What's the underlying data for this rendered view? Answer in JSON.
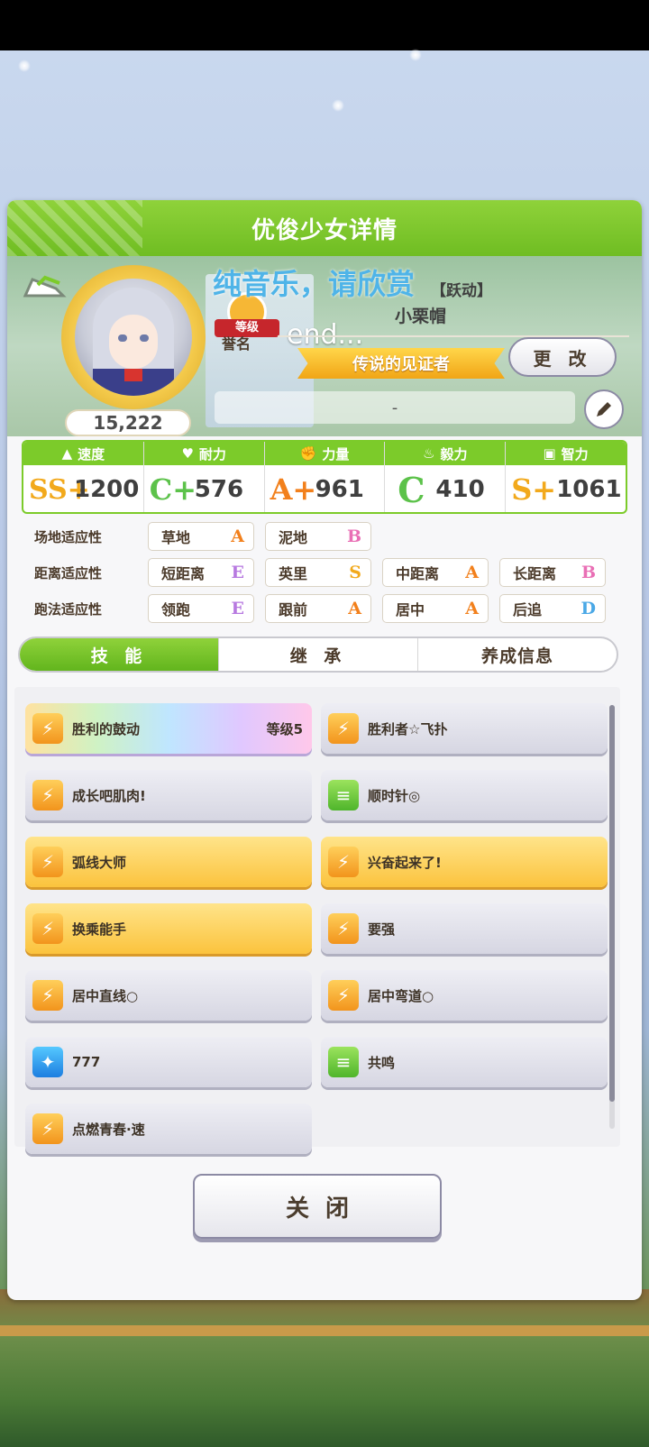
{
  "header": {
    "title": "优俊少女详情"
  },
  "profile": {
    "fans": "15,222",
    "rank_label": "等级",
    "title_label": "誉名",
    "overlay_text": "纯音乐，请欣赏",
    "overlay_end": "end...",
    "epithet_tag": "【跃动】",
    "horse_name": "小栗帽",
    "title_banner": "传说的见证者",
    "change_label": "更 改",
    "memo": "-"
  },
  "stats": [
    {
      "icon": "boot-icon",
      "glyph": "▲",
      "label": "速度",
      "grade": "SS+",
      "value": "1200",
      "grade_color": "#f2a91c"
    },
    {
      "icon": "heart-icon",
      "glyph": "♥",
      "label": "耐力",
      "grade": "C+",
      "value": "576",
      "grade_color": "#5cc24a"
    },
    {
      "icon": "arm-icon",
      "glyph": "✊",
      "label": "力量",
      "grade": "A+",
      "value": "961",
      "grade_color": "#f2801c"
    },
    {
      "icon": "flame-icon",
      "glyph": "♨",
      "label": "毅力",
      "grade": "C",
      "value": "410",
      "grade_color": "#5cc24a"
    },
    {
      "icon": "grad-cap-icon",
      "glyph": "▣",
      "label": "智力",
      "grade": "S+",
      "value": "1061",
      "grade_color": "#f2a91c"
    }
  ],
  "aptitude": [
    {
      "label": "场地适应性",
      "cells": [
        {
          "name": "草地",
          "grade": "A"
        },
        {
          "name": "泥地",
          "grade": "B"
        }
      ]
    },
    {
      "label": "距离适应性",
      "cells": [
        {
          "name": "短距离",
          "grade": "E"
        },
        {
          "name": "英里",
          "grade": "S"
        },
        {
          "name": "中距离",
          "grade": "A"
        },
        {
          "name": "长距离",
          "grade": "B"
        }
      ]
    },
    {
      "label": "跑法适应性",
      "cells": [
        {
          "name": "领跑",
          "grade": "E"
        },
        {
          "name": "跟前",
          "grade": "A"
        },
        {
          "name": "居中",
          "grade": "A"
        },
        {
          "name": "后追",
          "grade": "D"
        }
      ]
    }
  ],
  "grade_colors": {
    "S": "#f2a91c",
    "A": "#f2801c",
    "B": "#e96fb5",
    "C": "#5cc24a",
    "D": "#4aa8e6",
    "E": "#b779e0"
  },
  "tabs": [
    {
      "label": "技 能",
      "active": true
    },
    {
      "label": "继 承",
      "active": false
    },
    {
      "label": "养成信息",
      "active": false
    }
  ],
  "skills": [
    {
      "name": "胜利的鼓动",
      "level": "等级5",
      "style": "rainbow",
      "icon": "speed"
    },
    {
      "name": "胜利者☆飞扑",
      "level": "",
      "style": "plain",
      "icon": "speed"
    },
    {
      "name": "成长吧肌肉!",
      "level": "",
      "style": "plain",
      "icon": "speed"
    },
    {
      "name": "顺时针◎",
      "level": "",
      "style": "plain",
      "icon": "heal"
    },
    {
      "name": "弧线大师",
      "level": "",
      "style": "gold",
      "icon": "speed"
    },
    {
      "name": "兴奋起来了!",
      "level": "",
      "style": "gold",
      "icon": "speed"
    },
    {
      "name": "换乘能手",
      "level": "",
      "style": "gold",
      "icon": "speed"
    },
    {
      "name": "要强",
      "level": "",
      "style": "plain",
      "icon": "speed"
    },
    {
      "name": "居中直线○",
      "level": "",
      "style": "plain",
      "icon": "speed"
    },
    {
      "name": "居中弯道○",
      "level": "",
      "style": "plain",
      "icon": "speed"
    },
    {
      "name": "777",
      "level": "",
      "style": "plain",
      "icon": "star"
    },
    {
      "name": "共鸣",
      "level": "",
      "style": "plain",
      "icon": "heal"
    },
    {
      "name": "点燃青春·速",
      "level": "",
      "style": "plain",
      "icon": "speed"
    }
  ],
  "close_label": "关闭"
}
